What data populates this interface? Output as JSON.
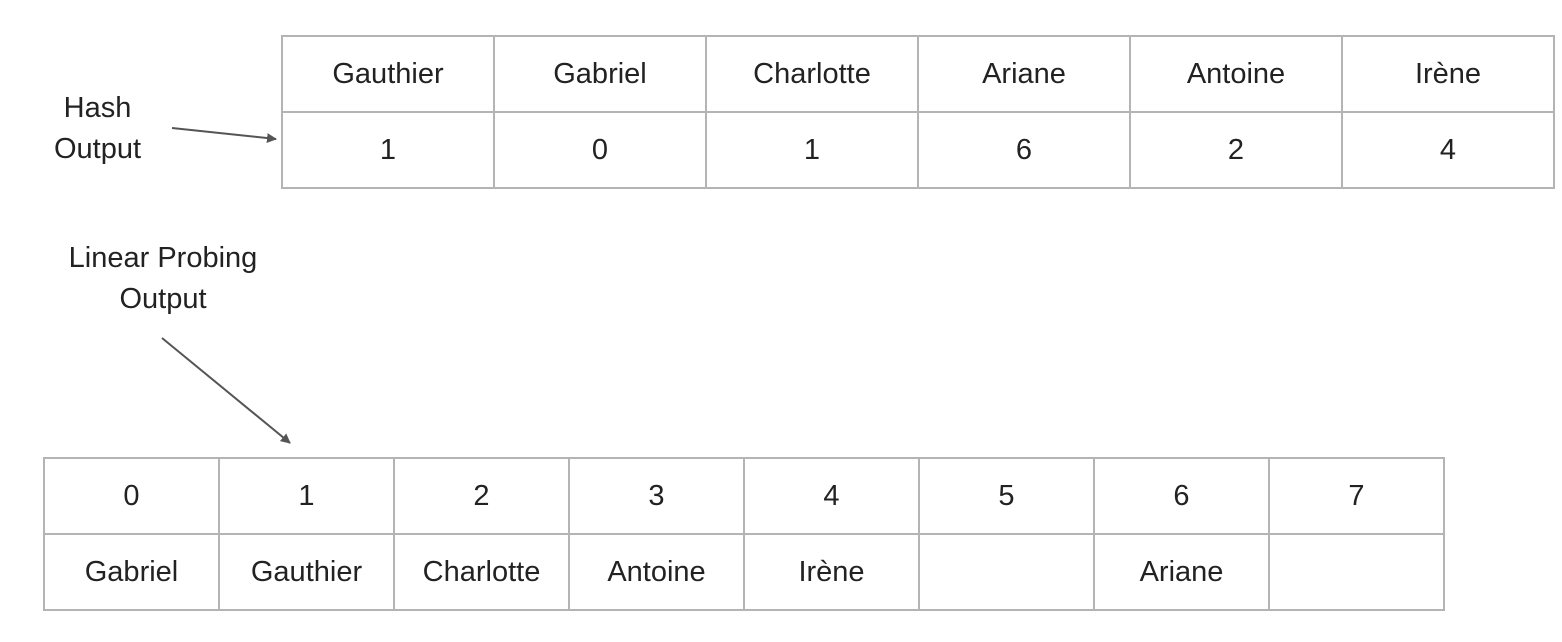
{
  "hash_label": [
    "Hash",
    "Output"
  ],
  "probe_label": [
    "Linear Probing",
    "Output"
  ],
  "hash_table": {
    "names": [
      "Gauthier",
      "Gabriel",
      "Charlotte",
      "Ariane",
      "Antoine",
      "Irène"
    ],
    "hashes": [
      "1",
      "0",
      "1",
      "6",
      "2",
      "4"
    ]
  },
  "probe_table": {
    "indices": [
      "0",
      "1",
      "2",
      "3",
      "4",
      "5",
      "6",
      "7"
    ],
    "slots": [
      "Gabriel",
      "Gauthier",
      "Charlotte",
      "Antoine",
      "Irène",
      "",
      "Ariane",
      ""
    ]
  },
  "colors": {
    "border": "#b4b4b4",
    "text": "#222222",
    "arrow": "#555555"
  }
}
